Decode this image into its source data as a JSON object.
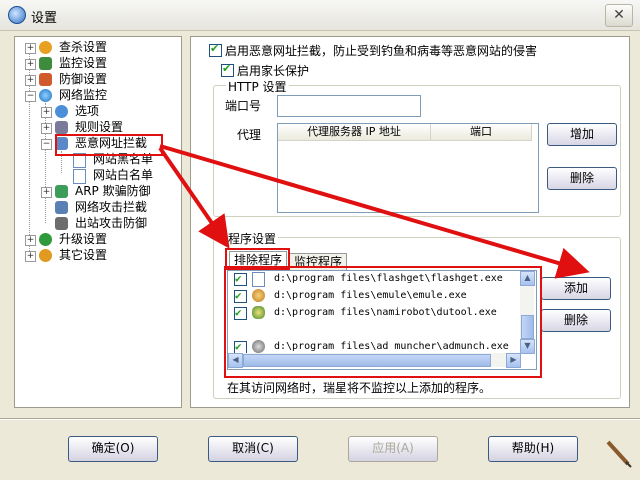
{
  "window": {
    "title": "设置",
    "close_glyph": "✕"
  },
  "tree": {
    "items": [
      {
        "label": "查杀设置"
      },
      {
        "label": "监控设置"
      },
      {
        "label": "防御设置"
      },
      {
        "label": "网络监控"
      },
      {
        "label": "选项"
      },
      {
        "label": "规则设置"
      },
      {
        "label": "恶意网址拦截"
      },
      {
        "label": "网站黑名单"
      },
      {
        "label": "网站白名单"
      },
      {
        "label": "ARP 欺骗防御"
      },
      {
        "label": "网络攻击拦截"
      },
      {
        "label": "出站攻击防御"
      },
      {
        "label": "升级设置"
      },
      {
        "label": "其它设置"
      }
    ]
  },
  "options": {
    "block_malicious": {
      "label": "启用恶意网址拦截，防止受到钓鱼和病毒等恶意网站的侵害",
      "checked": true
    },
    "parental": {
      "label": "启用家长保护",
      "checked": true
    }
  },
  "http": {
    "group_title": "HTTP 设置",
    "port_label": "端口号",
    "port_value": "",
    "proxy_label": "代理",
    "columns": [
      "代理服务器 IP 地址",
      "端口"
    ],
    "add_button": "增加",
    "delete_button": "删除"
  },
  "programs": {
    "group_title": "程序设置",
    "tabs": [
      "排除程序",
      "监控程序"
    ],
    "active_tab": 0,
    "rows": [
      {
        "path": "d:\\program files\\flashget\\flashget.exe",
        "checked": true,
        "icon": "flashget-icon"
      },
      {
        "path": "d:\\program files\\emule\\emule.exe",
        "checked": true,
        "icon": "emule-icon"
      },
      {
        "path": "d:\\program files\\namirobot\\dutool.exe",
        "checked": true,
        "icon": "namirobot-icon"
      },
      {
        "path": "d:\\program files\\ad muncher\\admunch.exe",
        "checked": true,
        "icon": "admuncher-icon"
      }
    ],
    "add_button": "添加",
    "delete_button": "删除",
    "note": "在其访问网络时，瑞星将不监控以上添加的程序。"
  },
  "footer": {
    "ok": "确定(O)",
    "cancel": "取消(C)",
    "apply": "应用(A)",
    "help": "帮助(H)"
  },
  "colors": {
    "annotation_red": "#e01010",
    "accent_blue": "#2f6fc5"
  }
}
